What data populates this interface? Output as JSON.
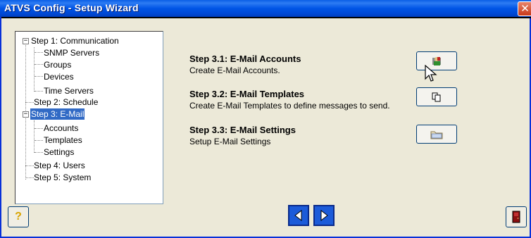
{
  "window": {
    "title": "ATVS Config - Setup Wizard",
    "close_glyph": "✕"
  },
  "tree": {
    "items": [
      {
        "label": "Step 1: Communication",
        "expander": "−",
        "selected": false
      },
      {
        "label": "SNMP Servers"
      },
      {
        "label": "Groups"
      },
      {
        "label": "Devices"
      },
      {
        "label": "Time Servers"
      },
      {
        "label": "Step 2: Schedule"
      },
      {
        "label": "Step 3: E-Mail",
        "expander": "−",
        "selected": true
      },
      {
        "label": "Accounts"
      },
      {
        "label": "Templates"
      },
      {
        "label": "Settings"
      },
      {
        "label": "Step 4: Users"
      },
      {
        "label": "Step 5: System"
      }
    ]
  },
  "steps": [
    {
      "title": "Step 3.1: E-Mail Accounts",
      "description": "Create E-Mail Accounts.",
      "icon": "email-accounts-icon"
    },
    {
      "title": "Step 3.2: E-Mail Templates",
      "description": "Create E-Mail Templates to define messages to send.",
      "icon": "copy-icon"
    },
    {
      "title": "Step 3.3: E-Mail Settings",
      "description": "Setup E-Mail Settings",
      "icon": "folder-icon"
    }
  ],
  "footer": {
    "help_glyph": "?",
    "back_icon": "arrow-left-icon",
    "next_icon": "arrow-right-icon",
    "exit_icon": "exit-door-icon"
  },
  "colors": {
    "titlebar": "#0055e5",
    "selection": "#316ac5",
    "nav_button": "#1c5bd9",
    "window_bg": "#ece9d8"
  }
}
